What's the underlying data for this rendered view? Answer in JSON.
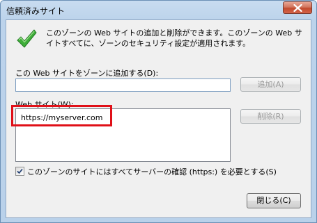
{
  "window": {
    "title": "信頼済みサイト"
  },
  "icons": {
    "zone_icon": "green-checkmark-icon",
    "close_icon": "close-x-icon",
    "checkbox_icon": "checkmark-icon"
  },
  "colors": {
    "highlight": "#e01018",
    "checkmark": "#2e9a2e",
    "close_button": "#c24a2e"
  },
  "description": "このゾーンの Web サイトの追加と削除ができます。このゾーンの Web サイトすべてに、ゾーンのセキュリティ設定が適用されます。",
  "add_section": {
    "label": "この Web サイトをゾーンに追加する(D):",
    "input_value": "",
    "add_button": "追加(A)"
  },
  "sites_section": {
    "label": "Web サイト(W):",
    "sites": [
      "https://myserver.com"
    ],
    "remove_button": "削除(R)"
  },
  "https_option": {
    "checked": true,
    "label": "このゾーンのサイトにはすべてサーバーの確認 (https:) を必要とする(S)"
  },
  "footer": {
    "close_button": "閉じる(C)"
  }
}
